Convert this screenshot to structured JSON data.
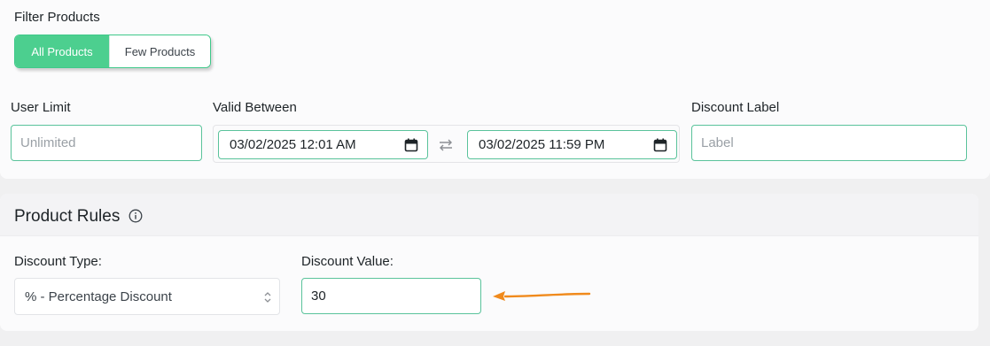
{
  "filter": {
    "title": "Filter Products",
    "options": [
      "All Products",
      "Few Products"
    ],
    "selected": "All Products"
  },
  "user_limit": {
    "label": "User Limit",
    "placeholder": "Unlimited",
    "value": ""
  },
  "valid_between": {
    "label": "Valid Between",
    "start": "03/02/2025 12:01 AM",
    "end": "03/02/2025 11:59 PM"
  },
  "discount_label": {
    "label": "Discount Label",
    "placeholder": "Label",
    "value": ""
  },
  "product_rules": {
    "title": "Product Rules",
    "discount_type": {
      "label": "Discount Type:",
      "value": "% - Percentage Discount"
    },
    "discount_value": {
      "label": "Discount Value:",
      "value": "30"
    }
  },
  "colors": {
    "accent": "#4ccf8f",
    "input_border": "#5ac39b",
    "annotation_arrow": "#f08a1c"
  },
  "icons": {
    "calendar": "calendar-icon",
    "swap": "swap-arrows-icon",
    "info": "info-icon",
    "select": "updown-chevron-icon"
  }
}
